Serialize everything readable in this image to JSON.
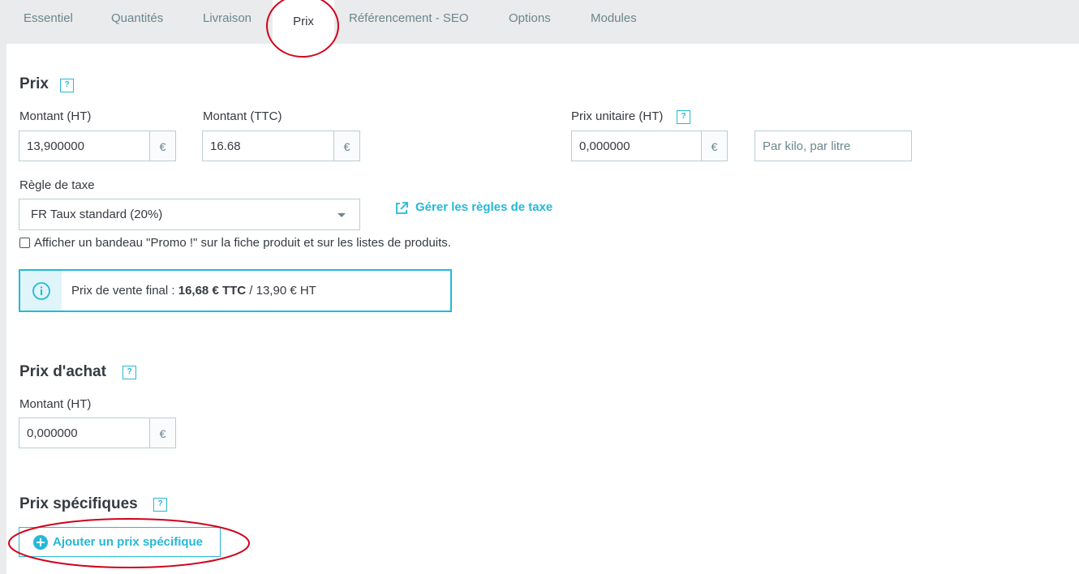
{
  "tabs": [
    {
      "label": "Essentiel"
    },
    {
      "label": "Quantités"
    },
    {
      "label": "Livraison"
    },
    {
      "label": "Prix"
    },
    {
      "label": "Référencement - SEO"
    },
    {
      "label": "Options"
    },
    {
      "label": "Modules"
    }
  ],
  "active_tab": "Prix",
  "prix": {
    "title": "Prix",
    "help": "?",
    "montant_ht": {
      "label": "Montant (HT)",
      "value": "13,900000",
      "currency": "€"
    },
    "montant_ttc": {
      "label": "Montant (TTC)",
      "value": "16.68",
      "currency": "€"
    },
    "prix_unitaire": {
      "label": "Prix unitaire (HT)",
      "help": "?",
      "value": "0,000000",
      "currency": "€"
    },
    "unit_placeholder": "Par kilo, par litre",
    "tax_rule": {
      "label": "Règle de taxe",
      "selected": "FR Taux standard (20%)"
    },
    "manage_tax_link": "Gérer les règles de taxe",
    "promo_checkbox": {
      "label": "Afficher un bandeau \"Promo !\" sur la fiche produit et sur les listes de produits.",
      "checked": false
    },
    "final_price": {
      "prefix": "Prix de vente final : ",
      "ttc": "16,68 € TTC",
      "separator": " / ",
      "ht": "13,90 € HT"
    }
  },
  "prix_achat": {
    "title": "Prix d'achat",
    "help": "?",
    "montant_ht": {
      "label": "Montant (HT)",
      "value": "0,000000",
      "currency": "€"
    }
  },
  "prix_specifiques": {
    "title": "Prix spécifiques",
    "help": "?",
    "add_button": "Ajouter un prix spécifique"
  },
  "colors": {
    "accent": "#25b9d7",
    "annotation": "#d0021b",
    "tabbar_bg": "#eaebec",
    "text": "#363a41"
  },
  "icons": {
    "help": "question-square-icon",
    "external_link": "external-link-icon",
    "info": "info-circle-icon",
    "add": "plus-circle-icon",
    "caret": "caret-down-icon"
  }
}
